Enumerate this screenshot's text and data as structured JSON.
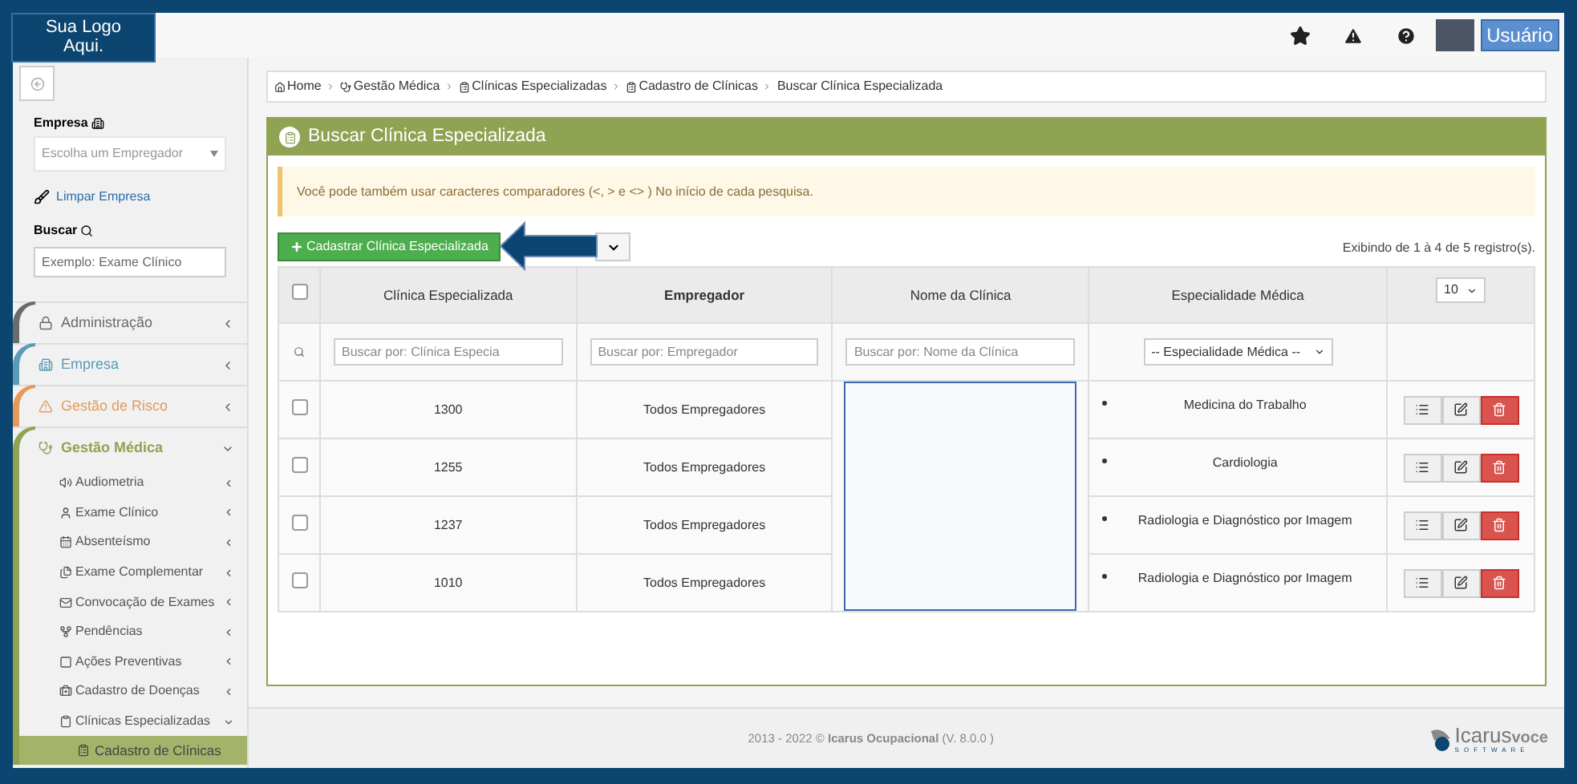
{
  "topbar": {
    "logo_text": "Sua Logo Aqui.",
    "user_button": "Usuário"
  },
  "sidebar": {
    "empresa_label": "Empresa",
    "empresa_select": {
      "placeholder": "Escolha um Empregador"
    },
    "clear_link": "Limpar Empresa",
    "search_label": "Buscar",
    "search": {
      "placeholder": "Exemplo: Exame Clínico"
    },
    "menu": [
      {
        "label": "Administração",
        "color": "#6b6b6b",
        "expanded": false
      },
      {
        "label": "Empresa",
        "color": "#5b9bb8",
        "expanded": false
      },
      {
        "label": "Gestão de Risco",
        "color": "#e59a5a",
        "expanded": false
      },
      {
        "label": "Gestão Médica",
        "color": "#8fa352",
        "expanded": true,
        "children": [
          {
            "label": "Audiometria",
            "expanded": false
          },
          {
            "label": "Exame Clínico",
            "expanded": false
          },
          {
            "label": "Absenteísmo",
            "expanded": false
          },
          {
            "label": "Exame Complementar",
            "expanded": false
          },
          {
            "label": "Convocação de Exames",
            "expanded": false
          },
          {
            "label": "Pendências",
            "expanded": false
          },
          {
            "label": "Ações Preventivas",
            "expanded": false
          },
          {
            "label": "Cadastro de Doenças",
            "expanded": false
          },
          {
            "label": "Clínicas Especializadas",
            "expanded": true,
            "children": [
              {
                "label": "Cadastro de Clínicas",
                "selected": true
              }
            ]
          }
        ]
      }
    ]
  },
  "breadcrumb": [
    "Home",
    "Gestão Médica",
    "Clínicas Especializadas",
    "Cadastro de Clínicas",
    "Buscar Clínica Especializada"
  ],
  "panel": {
    "title": "Buscar Clínica Especializada",
    "alert": "Você pode também usar caracteres comparadores (<, > e <> ) No início de cada pesquisa.",
    "add_button": "Cadastrar Clínica Especializada",
    "record_count": "Exibindo de 1 à 4 de 5 registro(s).",
    "table": {
      "columns": [
        "Clínica Especializada",
        "Empregador",
        "Nome da Clínica",
        "Especialidade Médica"
      ],
      "page_size": "10",
      "select_all_checked": false,
      "filters": [
        {
          "placeholder": "Buscar por: Clínica Especia"
        },
        {
          "placeholder": "Buscar por: Empregador"
        },
        {
          "placeholder": "Buscar por: Nome da Clínica"
        }
      ],
      "specialty_filter": "-- Especialidade Médica --",
      "rows": [
        {
          "code": "1300",
          "employer": "Todos Empregadores",
          "specialty": "Medicina do Trabalho",
          "checked": false
        },
        {
          "code": "1255",
          "employer": "Todos Empregadores",
          "specialty": "Cardiologia",
          "checked": false
        },
        {
          "code": "1237",
          "employer": "Todos Empregadores",
          "specialty": "Radiologia e Diagnóstico por Imagem",
          "checked": false
        },
        {
          "code": "1010",
          "employer": "Todos Empregadores",
          "specialty": "Radiologia e Diagnóstico por Imagem",
          "checked": false
        }
      ]
    }
  },
  "footer": {
    "years": "2013 - 2022 ©",
    "product": "Icarus Ocupacional",
    "version": "(V. 8.0.0 )",
    "logo_name": "Icarus",
    "logo_suffix": "voce",
    "logo_tagline": "SOFTWARE"
  }
}
